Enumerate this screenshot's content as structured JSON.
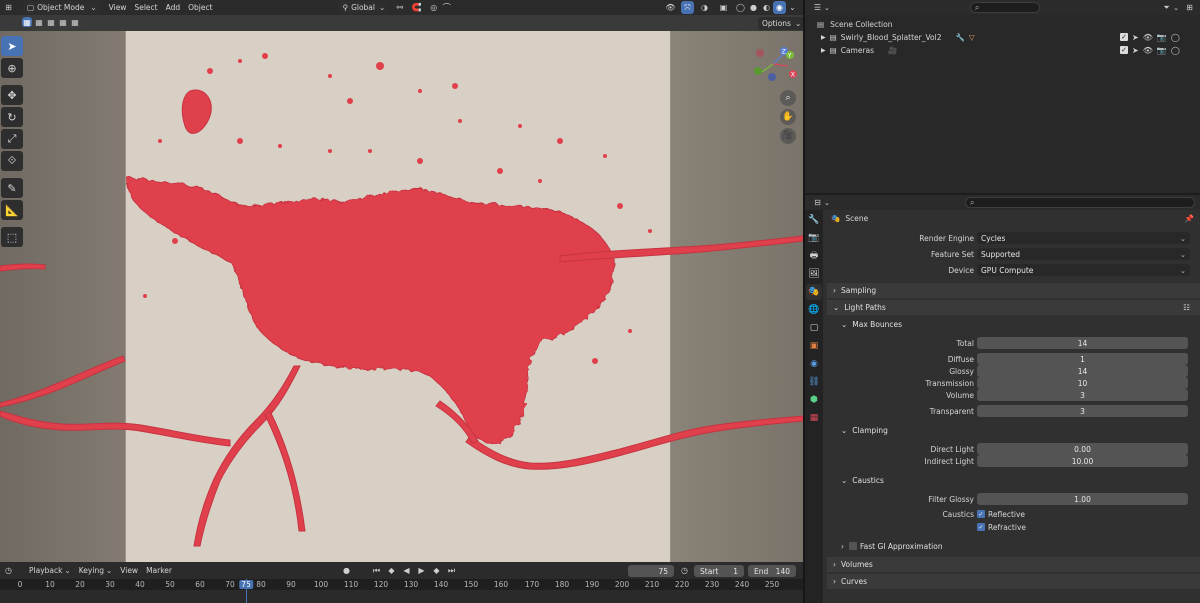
{
  "viewport": {
    "mode_label": "Object Mode",
    "menu": [
      "View",
      "Select",
      "Add",
      "Object"
    ],
    "transform_orientation": "Global",
    "options_label": "Options",
    "gizmo": {
      "x": "X",
      "y": "Y",
      "z": "Z"
    }
  },
  "timeline": {
    "menu": [
      "Playback",
      "Keying",
      "View",
      "Marker"
    ],
    "current_frame": "75",
    "start_label": "Start",
    "start_value": "1",
    "end_label": "End",
    "end_value": "140",
    "ticks": [
      "0",
      "10",
      "20",
      "30",
      "40",
      "50",
      "60",
      "70",
      "75",
      "80",
      "90",
      "100",
      "110",
      "120",
      "130",
      "140",
      "150",
      "160",
      "170",
      "180",
      "190",
      "200",
      "210",
      "220",
      "230",
      "240",
      "250"
    ]
  },
  "outliner": {
    "search_placeholder": "",
    "root_label": "Scene Collection",
    "items": [
      {
        "label": "Swirly_Blood_Splatter_Vol2"
      },
      {
        "label": "Cameras"
      }
    ]
  },
  "properties": {
    "context_label": "Scene",
    "render_engine_label": "Render Engine",
    "render_engine_value": "Cycles",
    "feature_set_label": "Feature Set",
    "feature_set_value": "Supported",
    "device_label": "Device",
    "device_value": "GPU Compute",
    "sampling_label": "Sampling",
    "light_paths_label": "Light Paths",
    "max_bounces_label": "Max Bounces",
    "bounces": [
      {
        "label": "Total",
        "value": "14"
      },
      {
        "label": "Diffuse",
        "value": "1"
      },
      {
        "label": "Glossy",
        "value": "14"
      },
      {
        "label": "Transmission",
        "value": "10"
      },
      {
        "label": "Volume",
        "value": "3"
      },
      {
        "label": "Transparent",
        "value": "3"
      }
    ],
    "clamping_label": "Clamping",
    "direct_light_label": "Direct Light",
    "direct_light_value": "0.00",
    "indirect_light_label": "Indirect Light",
    "indirect_light_value": "10.00",
    "caustics_label": "Caustics",
    "filter_glossy_label": "Filter Glossy",
    "filter_glossy_value": "1.00",
    "caustics_row_label": "Caustics",
    "reflective_label": "Reflective",
    "refractive_label": "Refractive",
    "fast_gi_label": "Fast GI Approximation",
    "volumes_label": "Volumes",
    "curves_label": "Curves"
  },
  "colors": {
    "accent": "#4772b3",
    "splatter": "#e0404c",
    "background_plane": "#d8d0c4"
  }
}
